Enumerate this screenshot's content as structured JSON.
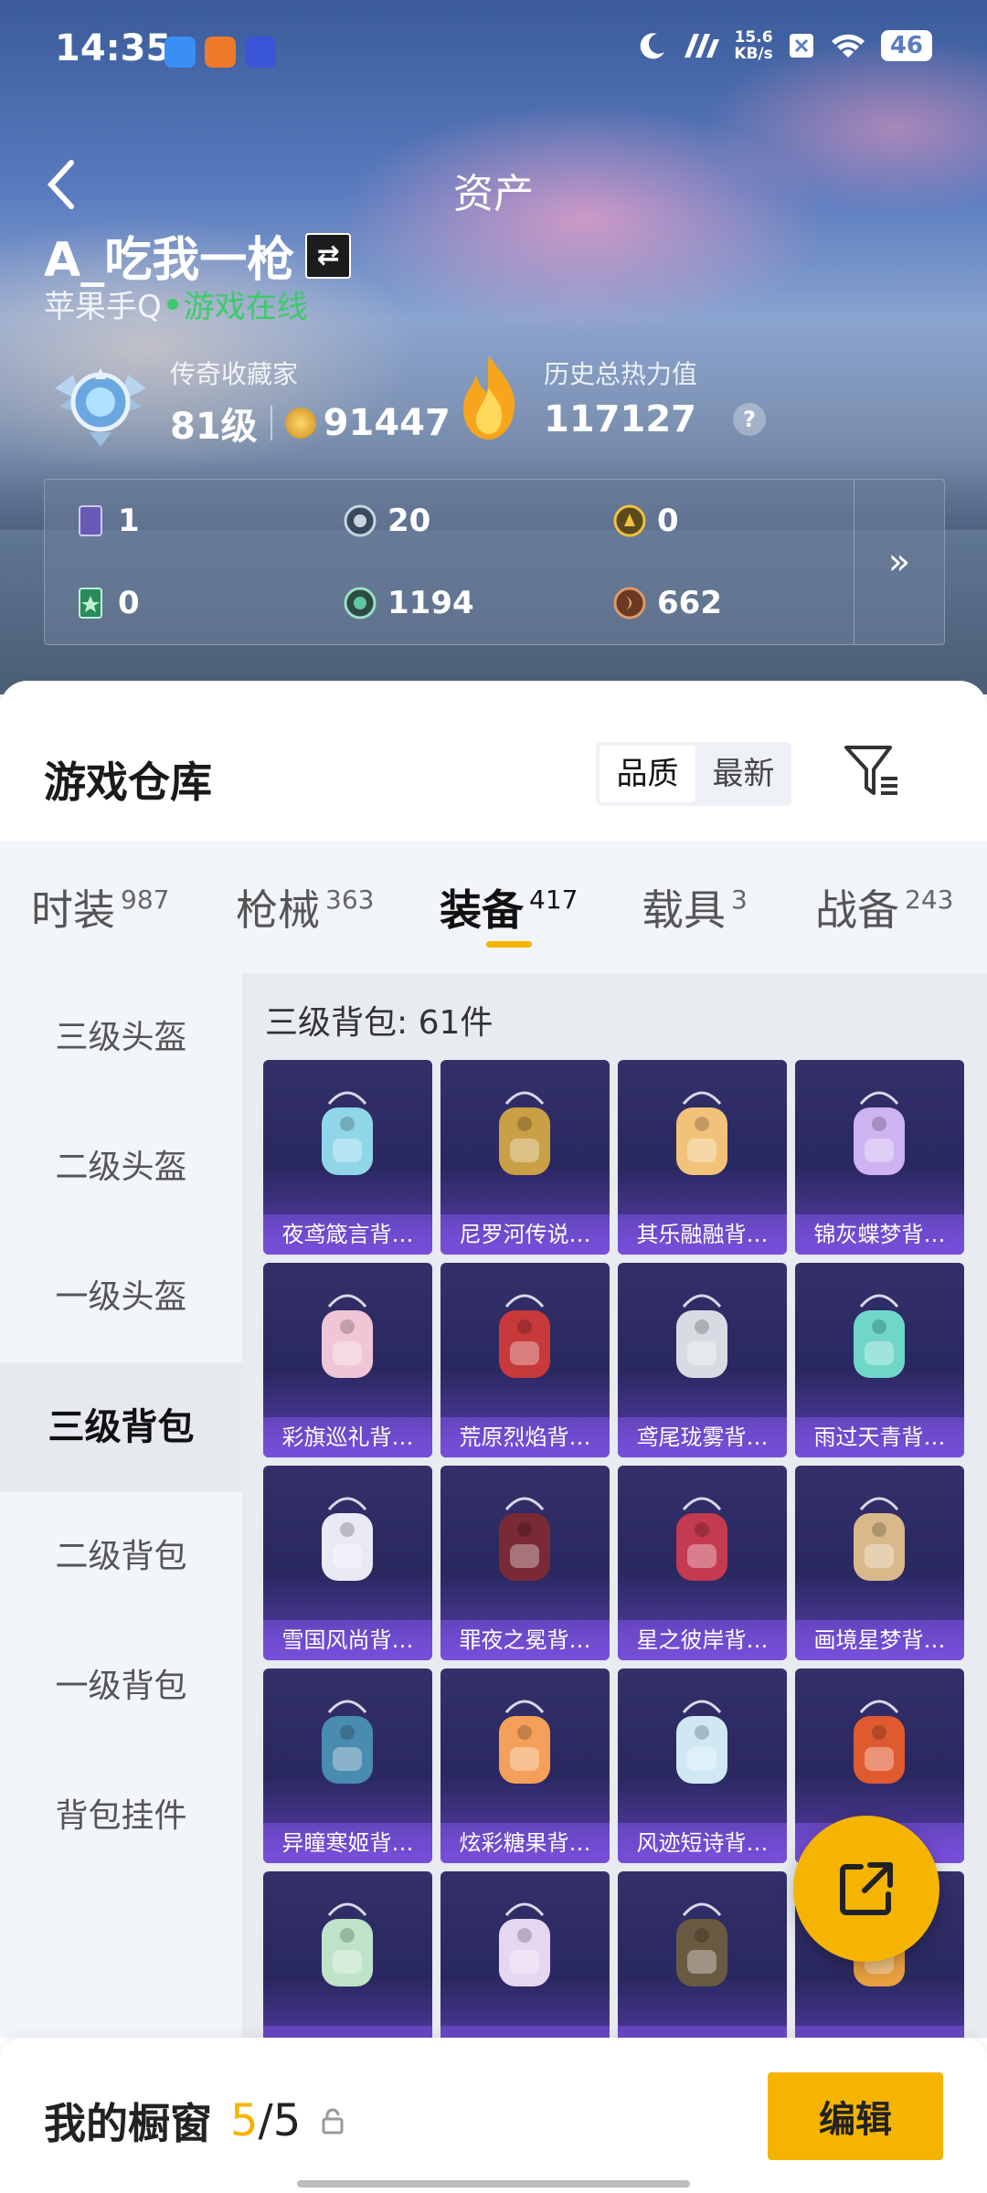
{
  "status_bar": {
    "time": "14:35",
    "speed_value": "15.6",
    "speed_unit": "KB/s",
    "battery": "46"
  },
  "header": {
    "title": "资产"
  },
  "profile": {
    "username": "A_吃我一枪",
    "platform": "苹果手Q",
    "online_status": "游戏在线"
  },
  "rank": {
    "label": "传奇收藏家",
    "level": "81级",
    "points": "91447"
  },
  "heat": {
    "label": "历史总热力值",
    "value": "117127"
  },
  "resources": [
    {
      "icon": "purple-card-icon",
      "value": "1"
    },
    {
      "icon": "silver-coin-icon",
      "value": "20"
    },
    {
      "icon": "gold-coin-icon",
      "value": "0"
    },
    {
      "icon": "green-card-icon",
      "value": "0"
    },
    {
      "icon": "green-coin-icon",
      "value": "1194"
    },
    {
      "icon": "bronze-coin-icon",
      "value": "662"
    }
  ],
  "resources_more": "»",
  "warehouse": {
    "title": "游戏仓库",
    "sort_options": [
      "品质",
      "最新"
    ],
    "active_sort": "品质"
  },
  "tabs": [
    {
      "label": "时装",
      "count": "987"
    },
    {
      "label": "枪械",
      "count": "363"
    },
    {
      "label": "装备",
      "count": "417"
    },
    {
      "label": "载具",
      "count": "3"
    },
    {
      "label": "战备",
      "count": "243"
    }
  ],
  "active_tab": "装备",
  "sidebar": [
    "三级头盔",
    "二级头盔",
    "一级头盔",
    "三级背包",
    "二级背包",
    "一级背包",
    "背包挂件"
  ],
  "active_sidebar": "三级背包",
  "content": {
    "count_label": "三级背包: 61件"
  },
  "items": [
    {
      "name": "夜鸢箴言背…",
      "color": "#8fd6e8"
    },
    {
      "name": "尼罗河传说…",
      "color": "#c9a045"
    },
    {
      "name": "其乐融融背…",
      "color": "#f2c27a"
    },
    {
      "name": "锦灰蝶梦背…",
      "color": "#cdb3f0"
    },
    {
      "name": "彩旗巡礼背…",
      "color": "#f0c6d6"
    },
    {
      "name": "荒原烈焰背…",
      "color": "#c8393a"
    },
    {
      "name": "鸢尾珑雾背…",
      "color": "#d8dce2"
    },
    {
      "name": "雨过天青背…",
      "color": "#6fd6c8"
    },
    {
      "name": "雪国风尚背…",
      "color": "#eaeaf6"
    },
    {
      "name": "罪夜之冕背…",
      "color": "#7a2a35"
    },
    {
      "name": "星之彼岸背…",
      "color": "#c43a50"
    },
    {
      "name": "画境星梦背…",
      "color": "#d9b98a"
    },
    {
      "name": "异瞳寒姬背…",
      "color": "#4a8bb0"
    },
    {
      "name": "炫彩糖果背…",
      "color": "#f4a05a"
    },
    {
      "name": "风迹短诗背…",
      "color": "#cfe8f4"
    },
    {
      "name": "",
      "color": "#e05a30"
    },
    {
      "name": "",
      "color": "#bfe3c8"
    },
    {
      "name": "",
      "color": "#e6d6f2"
    },
    {
      "name": "",
      "color": "#6a5a42"
    },
    {
      "name": "",
      "color": "#e8a040"
    }
  ],
  "bottom_bar": {
    "label": "我的橱窗",
    "current": "5",
    "total": "/5",
    "edit_label": "编辑"
  },
  "colors": {
    "accent": "#f5b400",
    "online": "#3ccb6a",
    "card_bg": "#2f2c66"
  }
}
